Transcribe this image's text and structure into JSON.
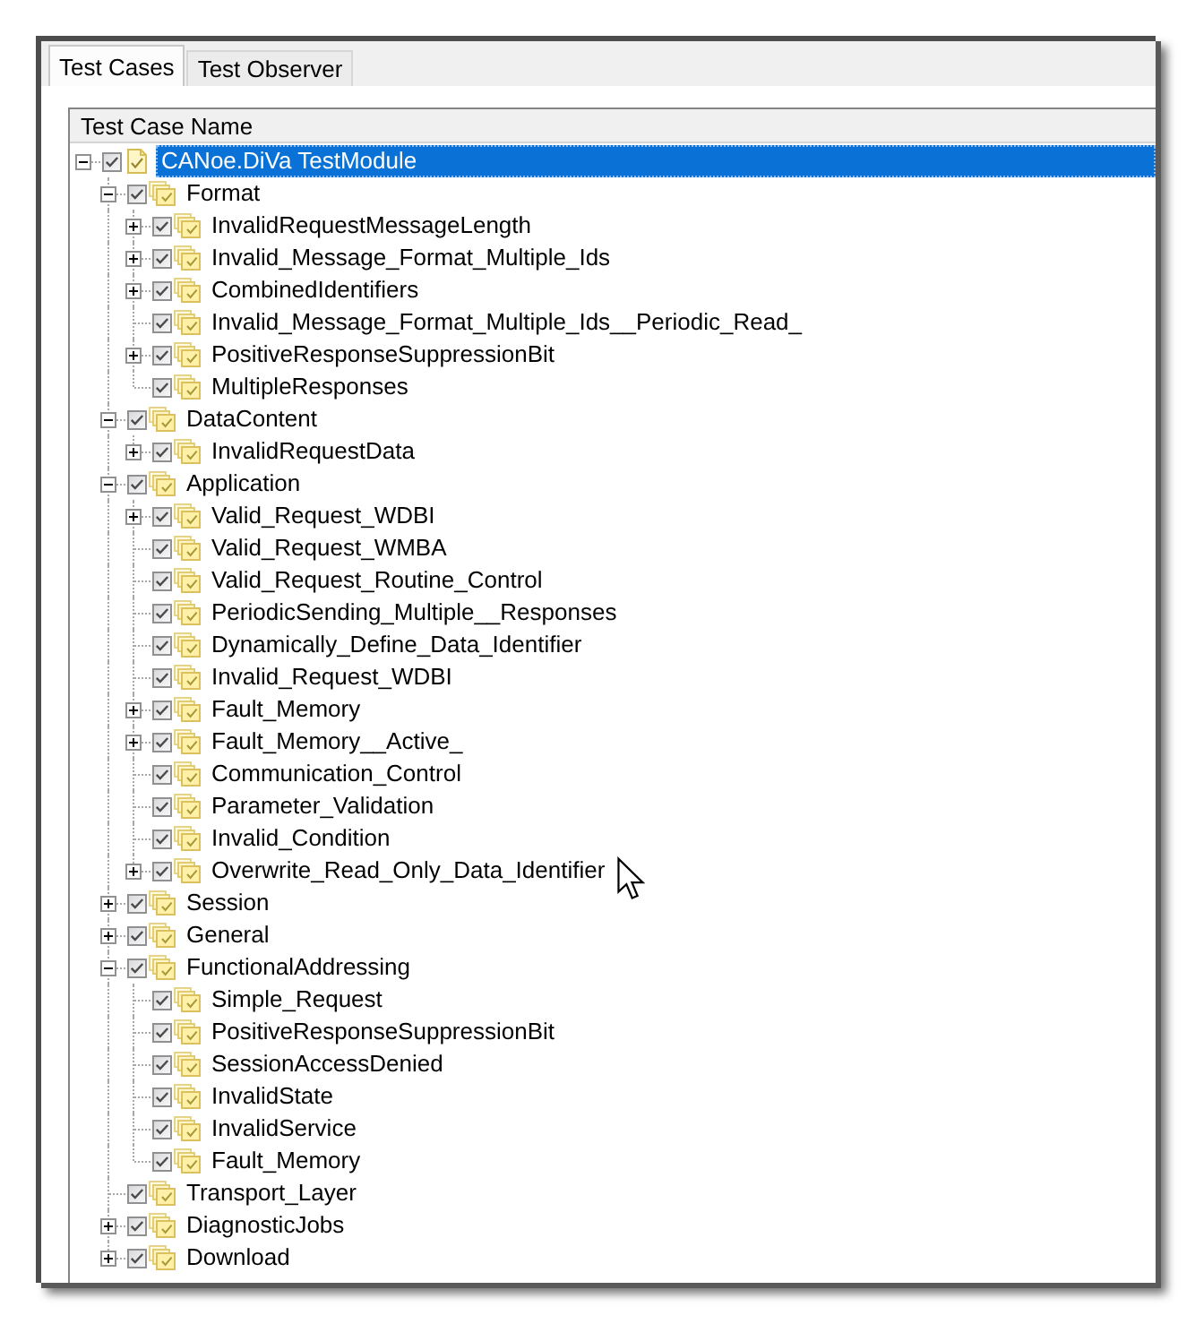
{
  "tabs": [
    {
      "label": "Test Cases",
      "selected": true
    },
    {
      "label": "Test Observer",
      "selected": false
    }
  ],
  "tree": {
    "column": "Test Case Name",
    "items": [
      {
        "label": "CANoe.DiVa TestModule",
        "kind": "module",
        "checked": true,
        "selected": true,
        "hovered": false,
        "expanded": true,
        "children": [
          {
            "label": "Format",
            "kind": "group",
            "checked": true,
            "selected": false,
            "hovered": false,
            "expanded": true,
            "children": [
              {
                "label": "InvalidRequestMessageLength",
                "kind": "group",
                "checked": true,
                "selected": false,
                "hovered": false,
                "expanded": false
              },
              {
                "label": "Invalid_Message_Format_Multiple_Ids",
                "kind": "group",
                "checked": true,
                "selected": false,
                "hovered": false,
                "expanded": false
              },
              {
                "label": "CombinedIdentifiers",
                "kind": "group",
                "checked": true,
                "selected": false,
                "hovered": false,
                "expanded": false
              },
              {
                "label": "Invalid_Message_Format_Multiple_Ids__Periodic_Read_",
                "kind": "group",
                "checked": true,
                "selected": false,
                "hovered": false
              },
              {
                "label": "PositiveResponseSuppressionBit",
                "kind": "group",
                "checked": true,
                "selected": false,
                "hovered": false,
                "expanded": false
              },
              {
                "label": "MultipleResponses",
                "kind": "group",
                "checked": true,
                "selected": false,
                "hovered": false
              }
            ]
          },
          {
            "label": "DataContent",
            "kind": "group",
            "checked": true,
            "selected": false,
            "hovered": false,
            "expanded": true,
            "children": [
              {
                "label": "InvalidRequestData",
                "kind": "group",
                "checked": true,
                "selected": false,
                "hovered": false,
                "expanded": false
              }
            ]
          },
          {
            "label": "Application",
            "kind": "group",
            "checked": true,
            "selected": false,
            "hovered": false,
            "expanded": true,
            "children": [
              {
                "label": "Valid_Request_WDBI",
                "kind": "group",
                "checked": true,
                "selected": false,
                "hovered": false,
                "expanded": false
              },
              {
                "label": "Valid_Request_WMBA",
                "kind": "group",
                "checked": true,
                "selected": false,
                "hovered": false
              },
              {
                "label": "Valid_Request_Routine_Control",
                "kind": "group",
                "checked": true,
                "selected": false,
                "hovered": false
              },
              {
                "label": "PeriodicSending_Multiple__Responses",
                "kind": "group",
                "checked": true,
                "selected": false,
                "hovered": false
              },
              {
                "label": "Dynamically_Define_Data_Identifier",
                "kind": "group",
                "checked": true,
                "selected": false,
                "hovered": false
              },
              {
                "label": "Invalid_Request_WDBI",
                "kind": "group",
                "checked": true,
                "selected": false,
                "hovered": false
              },
              {
                "label": "Fault_Memory",
                "kind": "group",
                "checked": true,
                "selected": false,
                "hovered": false,
                "expanded": false
              },
              {
                "label": "Fault_Memory__Active_",
                "kind": "group",
                "checked": true,
                "selected": false,
                "hovered": false,
                "expanded": false
              },
              {
                "label": "Communication_Control",
                "kind": "group",
                "checked": true,
                "selected": false,
                "hovered": false
              },
              {
                "label": "Parameter_Validation",
                "kind": "group",
                "checked": true,
                "selected": false,
                "hovered": false
              },
              {
                "label": "Invalid_Condition",
                "kind": "group",
                "checked": true,
                "selected": false,
                "hovered": false
              },
              {
                "label": "Overwrite_Read_Only_Data_Identifier",
                "kind": "group",
                "checked": true,
                "selected": false,
                "hovered": true,
                "expanded": false
              }
            ]
          },
          {
            "label": "Session",
            "kind": "group",
            "checked": true,
            "selected": false,
            "hovered": false,
            "expanded": false
          },
          {
            "label": "General",
            "kind": "group",
            "checked": true,
            "selected": false,
            "hovered": false,
            "expanded": false
          },
          {
            "label": "FunctionalAddressing",
            "kind": "group",
            "checked": true,
            "selected": false,
            "hovered": false,
            "expanded": true,
            "children": [
              {
                "label": "Simple_Request",
                "kind": "group",
                "checked": true,
                "selected": false,
                "hovered": false
              },
              {
                "label": "PositiveResponseSuppressionBit",
                "kind": "group",
                "checked": true,
                "selected": false,
                "hovered": false
              },
              {
                "label": "SessionAccessDenied",
                "kind": "group",
                "checked": true,
                "selected": false,
                "hovered": false
              },
              {
                "label": "InvalidState",
                "kind": "group",
                "checked": true,
                "selected": false,
                "hovered": false
              },
              {
                "label": "InvalidService",
                "kind": "group",
                "checked": true,
                "selected": false,
                "hovered": false
              },
              {
                "label": "Fault_Memory",
                "kind": "group",
                "checked": true,
                "selected": false,
                "hovered": false
              }
            ]
          },
          {
            "label": "Transport_Layer",
            "kind": "group",
            "checked": true,
            "selected": false,
            "hovered": false
          },
          {
            "label": "DiagnosticJobs",
            "kind": "group",
            "checked": true,
            "selected": false,
            "hovered": false,
            "expanded": false
          },
          {
            "label": "Download",
            "kind": "group",
            "checked": true,
            "selected": false,
            "hovered": false,
            "expanded": false
          }
        ]
      }
    ]
  }
}
